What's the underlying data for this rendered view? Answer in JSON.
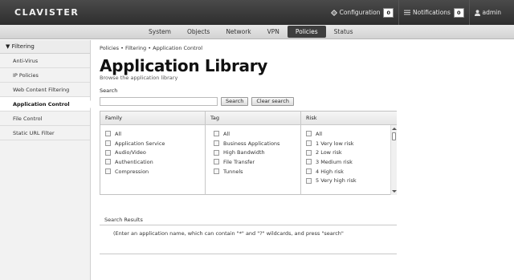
{
  "app": {
    "brand": "CLAVISTER",
    "configuration_label": "Configuration",
    "configuration_count": "0",
    "notifications_label": "Notifications",
    "notifications_count": "0",
    "user_label": "admin"
  },
  "nav": {
    "tabs": [
      "System",
      "Objects",
      "Network",
      "VPN",
      "Policies",
      "Status"
    ],
    "active": "Policies"
  },
  "sidebar": {
    "group": "Filtering",
    "items": [
      {
        "label": "Anti-Virus"
      },
      {
        "label": "IP Policies"
      },
      {
        "label": "Web Content Filtering"
      },
      {
        "label": "Application Control"
      },
      {
        "label": "File Control"
      },
      {
        "label": "Static URL Filter"
      }
    ],
    "active": "Application Control"
  },
  "main": {
    "breadcrumb": "Policies • Filtering • Application Control",
    "title": "Application Library",
    "subtitle": "Browse the application library",
    "search_label": "Search",
    "search_value": "",
    "search_button": "Search",
    "clear_button": "Clear search"
  },
  "filters": {
    "family": {
      "header": "Family",
      "options": [
        "All",
        "Application Service",
        "Audio/Video",
        "Authentication",
        "Compression"
      ]
    },
    "tag": {
      "header": "Tag",
      "options": [
        "All",
        "Business Applications",
        "High Bandwidth",
        "File Transfer",
        "Tunnels"
      ]
    },
    "risk": {
      "header": "Risk",
      "options": [
        "All",
        "1 Very low risk",
        "2 Low risk",
        "3 Medium risk",
        "4 High risk",
        "5 Very high risk"
      ]
    }
  },
  "results": {
    "header": "Search Results",
    "message": "(Enter an application name, which can contain \"*\" and \"?\" wildcards, and press \"search\""
  },
  "colors": {
    "topbar": "#3a3a3a",
    "active_tab": "#3e3e3e",
    "sidebar_bg": "#f2f2f2"
  }
}
